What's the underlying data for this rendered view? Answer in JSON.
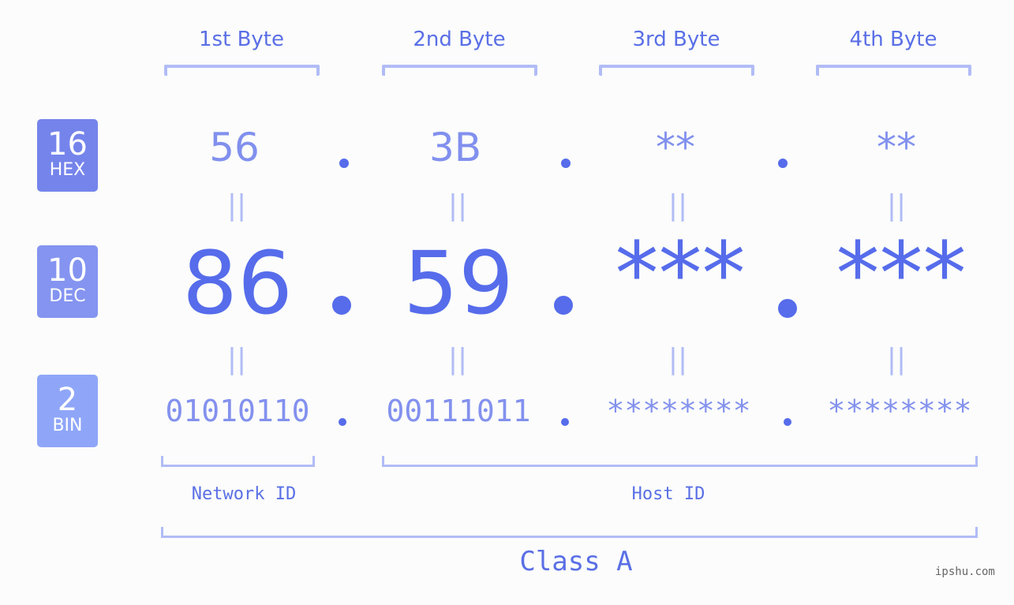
{
  "bytes": [
    {
      "header": "1st Byte",
      "hex": "56",
      "dec": "86",
      "bin": "01010110"
    },
    {
      "header": "2nd Byte",
      "hex": "3B",
      "dec": "59",
      "bin": "00111011"
    },
    {
      "header": "3rd Byte",
      "hex": "**",
      "dec": "***",
      "bin": "********"
    },
    {
      "header": "4th Byte",
      "hex": "**",
      "dec": "***",
      "bin": "********"
    }
  ],
  "bases": {
    "hex": {
      "num": "16",
      "label": "HEX",
      "color": "#7584eb"
    },
    "dec": {
      "num": "10",
      "label": "DEC",
      "color": "#8494f0"
    },
    "bin": {
      "num": "2",
      "label": "BIN",
      "color": "#8fa6f8"
    }
  },
  "equals_symbol": "||",
  "network_label": "Network ID",
  "host_label": "Host ID",
  "class_label": "Class A",
  "brand": "ipshu.com",
  "colors": {
    "primary": "#566ceb",
    "light": "#8190ee",
    "bracket": "#b1bcf6"
  }
}
